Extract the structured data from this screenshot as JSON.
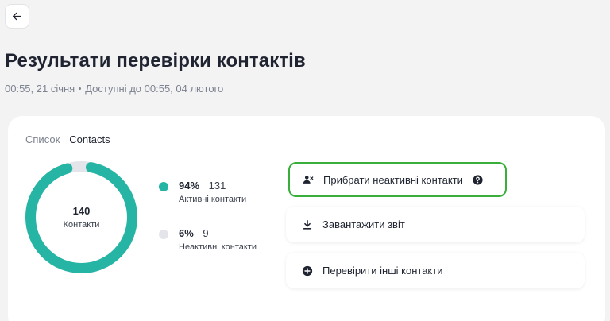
{
  "header": {
    "back_icon": "arrow-left-icon",
    "title": "Результати перевірки контактів",
    "created": "00:55, 21 січня",
    "available": "Доступні до 00:55, 04 лютого"
  },
  "tabs": [
    {
      "label": "Список"
    },
    {
      "label": "Contacts"
    }
  ],
  "summary": {
    "total": "140",
    "total_label": "Контакти",
    "active": {
      "percent": "94%",
      "count": "131",
      "label": "Активні контакти",
      "share": 0.94,
      "color": "#26b5a5"
    },
    "inactive": {
      "percent": "6%",
      "count": "9",
      "label": "Неактивні контакти",
      "share": 0.06,
      "color": "#e3e5ea"
    }
  },
  "actions": {
    "remove": {
      "label": "Прибрати неактивні контакти",
      "icon": "user-remove-icon",
      "help_icon": "question-circle-icon"
    },
    "download": {
      "label": "Завантажити звіт",
      "icon": "download-icon"
    },
    "check": {
      "label": "Перевірити інші контакти",
      "icon": "plus-circle-icon"
    }
  },
  "colors": {
    "accent": "#26b5a5",
    "highlight_border": "#3aae3a",
    "text": "#1f2430",
    "muted": "#7d8290"
  }
}
